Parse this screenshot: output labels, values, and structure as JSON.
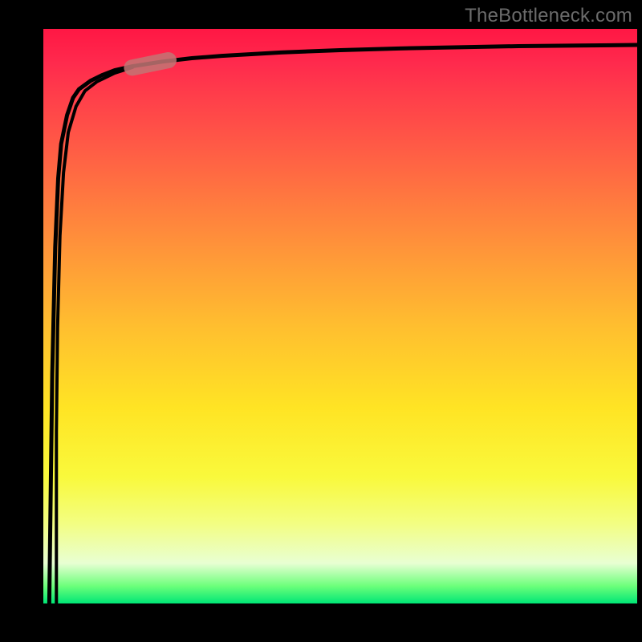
{
  "attribution": "TheBottleneck.com",
  "gradient": {
    "top": "#ff1744",
    "mid_upper": "#ff7a3f",
    "mid": "#ffe424",
    "mid_lower": "#f3fe81",
    "bottom": "#00e676"
  },
  "chart_data": {
    "type": "line",
    "title": "",
    "xlabel": "",
    "ylabel": "",
    "xlim": [
      0,
      100
    ],
    "ylim": [
      0,
      100
    ],
    "grid": false,
    "legend": null,
    "series": [
      {
        "name": "curve",
        "x": [
          1,
          1.5,
          2,
          2.5,
          3,
          4,
          5,
          6,
          8,
          10,
          12,
          15,
          20,
          25,
          30,
          40,
          50,
          60,
          70,
          80,
          90,
          100
        ],
        "y": [
          0,
          40,
          62,
          74,
          80,
          85,
          88,
          89.5,
          91,
          92,
          92.8,
          93.5,
          94.3,
          94.9,
          95.3,
          95.9,
          96.3,
          96.6,
          96.8,
          97.0,
          97.1,
          97.2
        ]
      }
    ],
    "marker": {
      "name": "highlight-pill",
      "x_range": [
        14,
        22
      ],
      "y_range": [
        93,
        95
      ],
      "color": "#c27574",
      "opacity": 0.85
    }
  }
}
